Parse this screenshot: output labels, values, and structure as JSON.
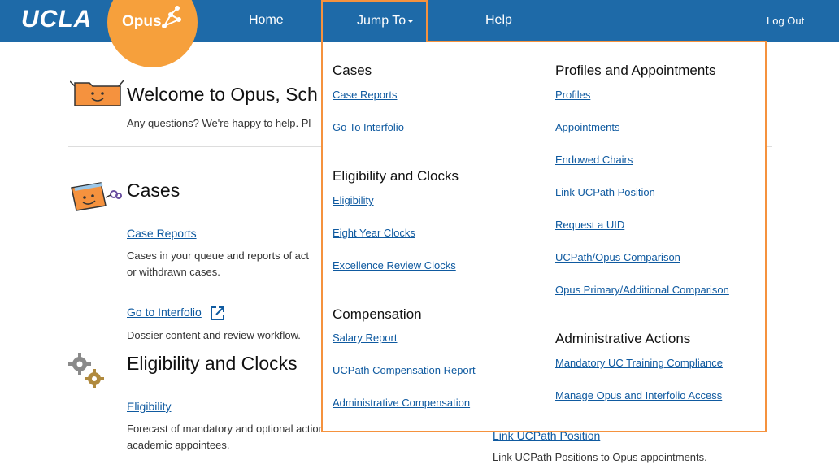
{
  "topbar": {
    "logo": "UCLA",
    "app_name": "Opus",
    "nav": {
      "home": "Home",
      "jump_to": "Jump To",
      "help": "Help",
      "logout": "Log Out"
    }
  },
  "welcome": {
    "title": "Welcome to Opus, Sch",
    "subtitle": "Any questions? We're happy to help. Pl"
  },
  "cases": {
    "title": "Cases",
    "case_reports_link": "Case Reports",
    "case_reports_desc_1": "Cases in your queue and reports of act",
    "case_reports_desc_2": "or withdrawn cases.",
    "interfolio_link": "Go to Interfolio",
    "interfolio_desc": "Dossier content and review workflow."
  },
  "eligibility": {
    "title": "Eligibility and Clocks",
    "link": "Eligibility",
    "desc_1": "Forecast of mandatory and optional actions for",
    "desc_2": "academic appointees."
  },
  "right_column": {
    "link": "Link UCPath Position",
    "desc": "Link UCPath Positions to Opus appointments."
  },
  "dropdown": {
    "cases": {
      "heading": "Cases",
      "items": [
        "Case Reports",
        "Go To Interfolio"
      ]
    },
    "eligibility": {
      "heading": "Eligibility and Clocks",
      "items": [
        "Eligibility",
        "Eight Year Clocks",
        "Excellence Review Clocks"
      ]
    },
    "compensation": {
      "heading": "Compensation",
      "items": [
        "Salary Report",
        "UCPath Compensation Report",
        "Administrative Compensation"
      ]
    },
    "profiles": {
      "heading": "Profiles and Appointments",
      "items": [
        "Profiles",
        "Appointments",
        "Endowed Chairs",
        "Link UCPath Position",
        "Request a UID",
        "UCPath/Opus Comparison",
        "Opus Primary/Additional Comparison"
      ]
    },
    "admin": {
      "heading": "Administrative Actions",
      "items": [
        "Mandatory UC Training Compliance",
        "Manage Opus and Interfolio Access"
      ]
    }
  },
  "colors": {
    "nav_blue": "#1e6aa8",
    "opus_orange": "#f6a03c",
    "highlight_orange": "#f5923e",
    "link_blue": "#0f5aa0"
  },
  "icons": [
    "folder-smiley-icon",
    "cases-folder-icon",
    "external-link-icon",
    "gears-icon",
    "opus-network-icon",
    "caret-down-icon"
  ]
}
